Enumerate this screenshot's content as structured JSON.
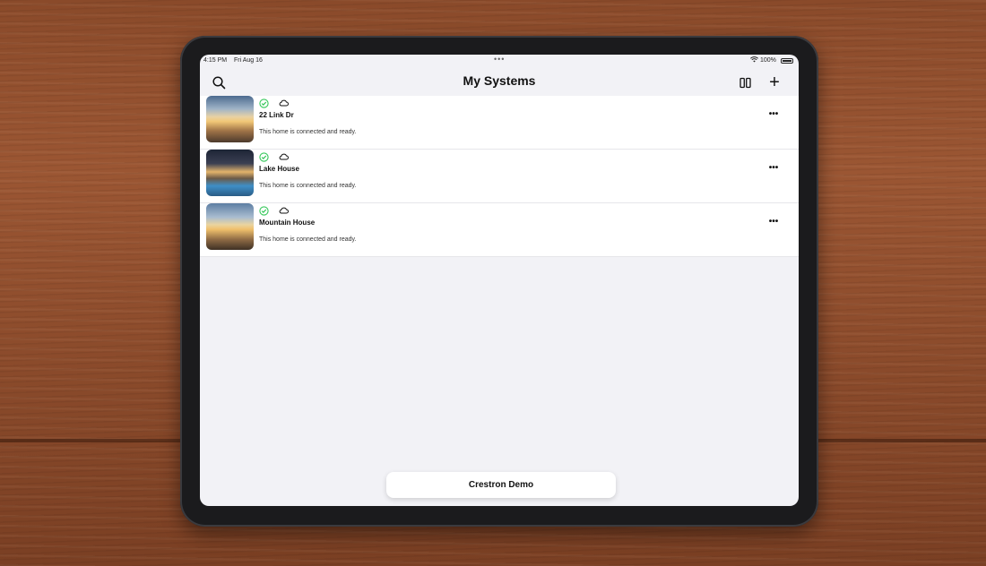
{
  "status_bar": {
    "time": "4:15 PM",
    "date": "Fri Aug 16",
    "multitask_dots": "•••",
    "battery": "100%"
  },
  "header": {
    "title": "My Systems",
    "icons": {
      "search": "search-icon",
      "split": "split-view-icon",
      "add": "plus-icon"
    },
    "add_glyph": "+"
  },
  "systems": [
    {
      "name": "22 Link Dr",
      "description": "This home is connected and ready.",
      "more": "•••"
    },
    {
      "name": "Lake House",
      "description": "This home is connected and ready.",
      "more": "•••"
    },
    {
      "name": "Mountain House",
      "description": "This home is connected and ready.",
      "more": "•••"
    }
  ],
  "footer": {
    "account_label": "Crestron Demo"
  },
  "colors": {
    "accent_green": "#34c759",
    "background": "#f2f2f6"
  }
}
